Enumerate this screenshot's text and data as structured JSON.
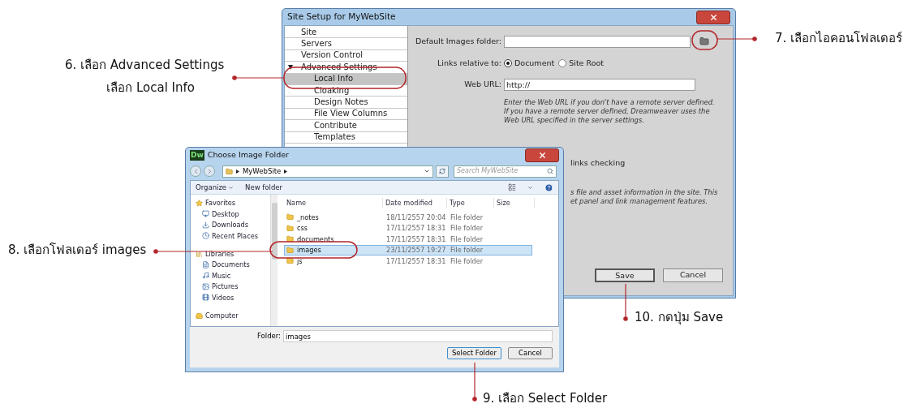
{
  "site_setup": {
    "title": "Site Setup for MyWebSite",
    "sidebar": [
      {
        "label": "Site",
        "selected": false
      },
      {
        "label": "Servers",
        "selected": false
      },
      {
        "label": "Version Control",
        "selected": false
      },
      {
        "label": "Advanced Settings",
        "selected": false,
        "expanded": true,
        "children": [
          {
            "label": "Local Info",
            "selected": true
          },
          {
            "label": "Cloaking",
            "selected": false
          },
          {
            "label": "Design Notes",
            "selected": false
          },
          {
            "label": "File View Columns",
            "selected": false
          },
          {
            "label": "Contribute",
            "selected": false
          },
          {
            "label": "Templates",
            "selected": false
          }
        ]
      }
    ],
    "default_images_folder": {
      "label": "Default Images folder:"
    },
    "links_relative_to": {
      "label": "Links relative to:",
      "options": [
        {
          "label": "Document",
          "selected": true
        },
        {
          "label": "Site Root",
          "selected": false
        }
      ]
    },
    "web_url": {
      "label": "Web URL:",
      "value": "http://"
    },
    "help_text": "Enter the Web URL if you don't have a remote server defined. If you have a remote server defined, Dreamweaver uses the Web URL specified in the server settings.",
    "partial_checkbox_label": "links checking",
    "partial_help_lines": [
      "s file and asset information in the site. This",
      "et panel and link management features."
    ],
    "buttons": [
      "Save",
      "Cancel"
    ]
  },
  "choose_folder": {
    "title": "Choose Image Folder",
    "app_badge": "Dw",
    "path": [
      "MyWebSite"
    ],
    "search_placeholder": "Search MyWebSite",
    "toolbar": [
      "Organize",
      "New folder"
    ],
    "nav": [
      {
        "label": "Favorites",
        "children": [
          {
            "label": "Desktop"
          },
          {
            "label": "Downloads"
          },
          {
            "label": "Recent Places"
          }
        ]
      },
      {
        "label": "Libraries",
        "children": [
          {
            "label": "Documents"
          },
          {
            "label": "Music"
          },
          {
            "label": "Pictures"
          },
          {
            "label": "Videos"
          }
        ]
      },
      {
        "label": "Computer"
      }
    ],
    "columns": [
      "Name",
      "Date modified",
      "Type",
      "Size"
    ],
    "rows": [
      {
        "name": "_notes",
        "date": "18/11/2557 20:04",
        "type": "File folder",
        "selected": false
      },
      {
        "name": "css",
        "date": "17/11/2557 18:31",
        "type": "File folder",
        "selected": false
      },
      {
        "name": "documents",
        "date": "17/11/2557 18:31",
        "type": "File folder",
        "selected": false
      },
      {
        "name": "images",
        "date": "23/11/2557 19:27",
        "type": "File folder",
        "selected": true
      },
      {
        "name": "js",
        "date": "17/11/2557 18:31",
        "type": "File folder",
        "selected": false
      }
    ],
    "folder_field": {
      "label": "Folder:",
      "value": "images"
    },
    "buttons": [
      "Select Folder",
      "Cancel"
    ]
  },
  "annotations": [
    {
      "lines": [
        "6. เลือก Advanced Settings",
        "เลือก Local Info"
      ]
    },
    {
      "lines": [
        "7. เลือกไอคอนโฟลเดอร์"
      ]
    },
    {
      "lines": [
        "8. เลือกโฟลเดอร์ images"
      ]
    },
    {
      "lines": [
        "9. เลือก Select Folder"
      ]
    },
    {
      "lines": [
        "10. กดปุ่ม Save"
      ]
    }
  ]
}
